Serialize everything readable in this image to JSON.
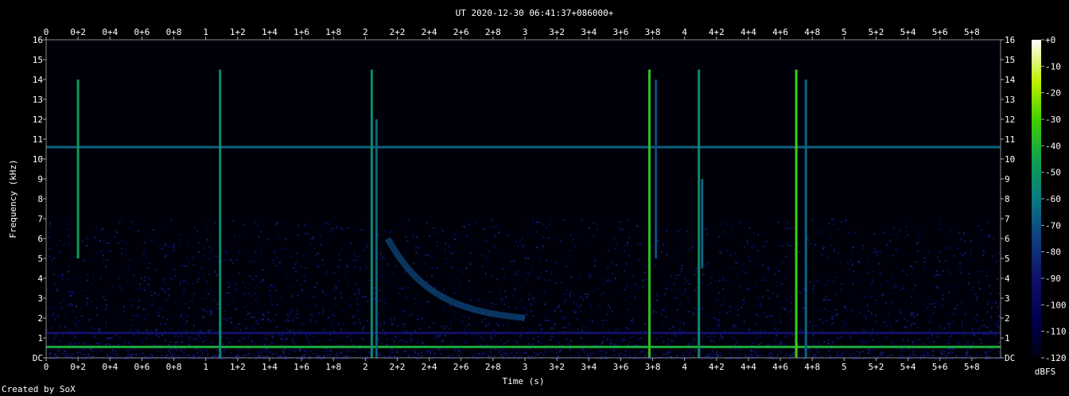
{
  "chart_data": {
    "type": "heatmap",
    "title": "UT 2020-12-30 06:41:37+086000+",
    "xlabel": "Time (s)",
    "ylabel": "Frequency (kHz)",
    "xlim": [
      0,
      5.98
    ],
    "ylim": [
      0,
      16
    ],
    "x_ticks": [
      "0",
      "0+2",
      "0+4",
      "0+6",
      "0+8",
      "1",
      "1+2",
      "1+4",
      "1+6",
      "1+8",
      "2",
      "2+2",
      "2+4",
      "2+6",
      "2+8",
      "3",
      "3+2",
      "3+4",
      "3+6",
      "3+8",
      "4",
      "4+2",
      "4+4",
      "4+6",
      "4+8",
      "5",
      "5+2",
      "5+4",
      "5+6",
      "5+8"
    ],
    "y_ticks": [
      "DC",
      "1",
      "2",
      "3",
      "4",
      "5",
      "6",
      "7",
      "8",
      "9",
      "10",
      "11",
      "12",
      "13",
      "14",
      "15",
      "16"
    ],
    "colorbar": {
      "label": "dBFS",
      "ticks": [
        "+0",
        "-10",
        "-20",
        "-30",
        "-40",
        "-50",
        "-60",
        "-70",
        "-80",
        "-90",
        "-100",
        "-110",
        "-120"
      ],
      "range": [
        -120,
        0
      ]
    },
    "features": [
      {
        "kind": "hline",
        "freq_khz": 0.55,
        "level": 0.65
      },
      {
        "kind": "hline",
        "freq_khz": 10.6,
        "level": 0.45
      },
      {
        "kind": "hline",
        "freq_khz": 1.25,
        "level": 0.25
      },
      {
        "kind": "impulse",
        "time_s": 0.2,
        "f_low": 5,
        "f_high": 14,
        "level": 0.6
      },
      {
        "kind": "impulse",
        "time_s": 1.09,
        "f_low": 0,
        "f_high": 14.5,
        "level": 0.55
      },
      {
        "kind": "impulse",
        "time_s": 2.04,
        "f_low": 0,
        "f_high": 14.5,
        "level": 0.55
      },
      {
        "kind": "impulse",
        "time_s": 2.07,
        "f_low": 0,
        "f_high": 12,
        "level": 0.45
      },
      {
        "kind": "impulse",
        "time_s": 3.78,
        "f_low": 0,
        "f_high": 14.5,
        "level": 0.7
      },
      {
        "kind": "impulse",
        "time_s": 3.82,
        "f_low": 5,
        "f_high": 14,
        "level": 0.4
      },
      {
        "kind": "impulse",
        "time_s": 4.09,
        "f_low": 0,
        "f_high": 14.5,
        "level": 0.55
      },
      {
        "kind": "impulse",
        "time_s": 4.11,
        "f_low": 4.5,
        "f_high": 9,
        "level": 0.45
      },
      {
        "kind": "impulse",
        "time_s": 4.7,
        "f_low": 0,
        "f_high": 14.5,
        "level": 0.75
      },
      {
        "kind": "impulse",
        "time_s": 4.76,
        "f_low": 0,
        "f_high": 14,
        "level": 0.45
      },
      {
        "kind": "sweep",
        "t_start": 2.14,
        "t_end": 3.0,
        "f_start": 6,
        "f_end": 1.8,
        "level": 0.4
      }
    ]
  },
  "footer": {
    "credit": "Created by SoX"
  }
}
